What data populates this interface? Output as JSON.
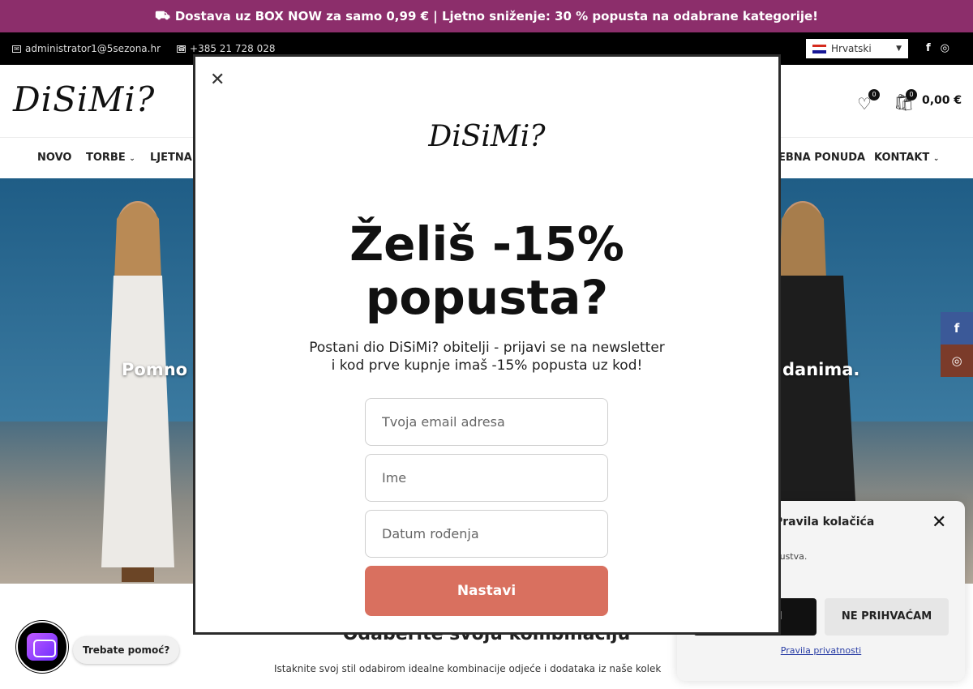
{
  "promo": {
    "text": "Dostava uz BOX NOW za samo 0,99 € | Ljetno sniženje: 30 % popusta na odabrane kategorije!",
    "truck_icon": "truck-icon",
    "tag_icon": "tag-icon"
  },
  "topbar": {
    "email": "administrator1@5sezona.hr",
    "phone": "+385 21 728 028",
    "language": "Hrvatski",
    "social": [
      "f",
      "instagram"
    ]
  },
  "header": {
    "logo": "DiSiMi?",
    "wishlist_count": "0",
    "cart_count": "0",
    "cart_total": "0,00 €"
  },
  "nav": {
    "items": [
      "NOVO",
      "TORBE",
      "LJETNA",
      "EBNA PONUDA",
      "KONTAKT"
    ]
  },
  "hero": {
    "caption_left": "Pomno i",
    "caption_right": "danima."
  },
  "below": {
    "title": "Odaberite svoju kombinaciju",
    "subtitle": "Istaknite svoj stil odabirom idealne kombinacije odjeće i dodataka iz naše kolek"
  },
  "chat": {
    "label": "Trebate pomoć?"
  },
  "cookie": {
    "title": "Pravila kolačića",
    "description": "oristi kolačiće za skustva.",
    "accept": "PRIHVATI",
    "deny": "NE PRIHVAĆAM",
    "policy": "Pravila privatnosti"
  },
  "modal": {
    "logo": "DiSiMi?",
    "headline_line1": "Želiš -15%",
    "headline_line2": "popusta?",
    "sub_line1": "Postani dio DiSiMi? obitelji - prijavi se na newsletter",
    "sub_line2": "i kod prve kupnje imaš -15% popusta uz kod!",
    "email_placeholder": "Tvoja email adresa",
    "name_placeholder": "Ime",
    "dob_placeholder": "Datum rođenja",
    "submit": "Nastavi"
  },
  "colors": {
    "promo_bg": "#8c2e6b",
    "submit_bg": "#d9705f",
    "facebook": "#3b5998",
    "instagram": "#7b3b2a"
  }
}
